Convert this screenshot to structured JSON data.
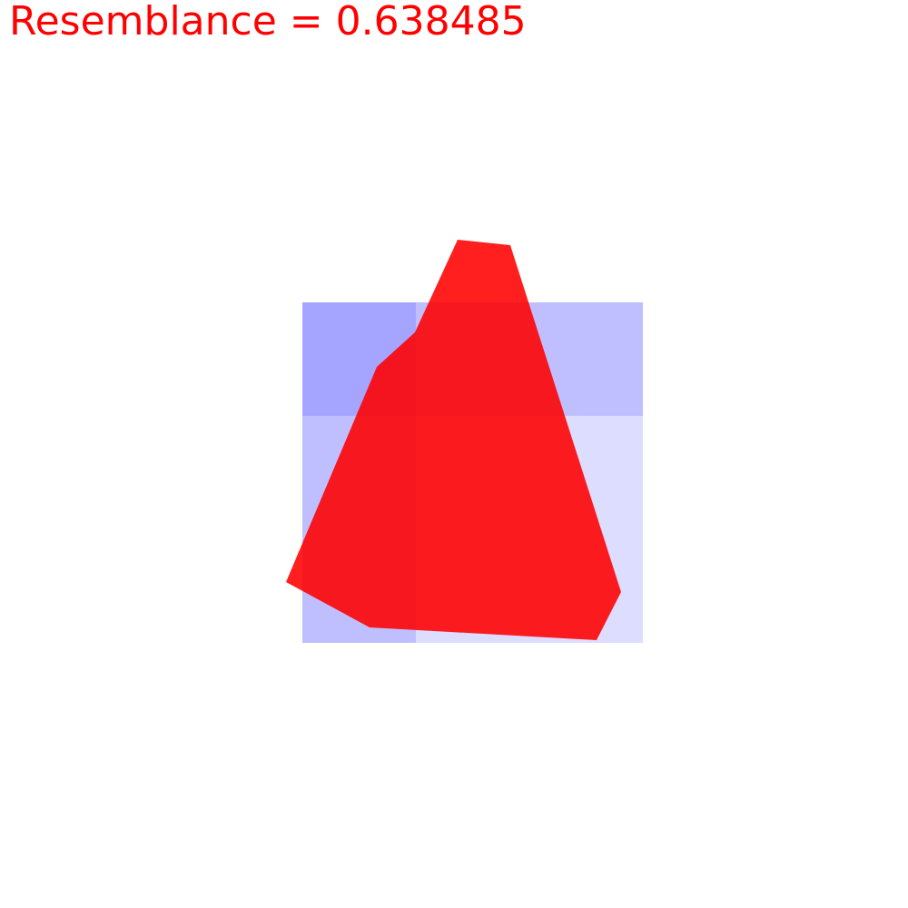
{
  "header": {
    "label": "Resemblance",
    "separator": " = ",
    "value": "0.638485",
    "text": "Resemblance = 0.638485"
  },
  "colors": {
    "title": "#ff0000",
    "red_polygon": "#ff0000",
    "blue_grid": "#0000ff",
    "background": "#ffffff"
  },
  "scene": {
    "resemblance": 0.638485,
    "grid_layers": 3,
    "blue_cell_opacity": 0.133,
    "red_polygon_opacity": 0.88,
    "shapes": [
      "blue-grid",
      "red-polygon"
    ]
  }
}
